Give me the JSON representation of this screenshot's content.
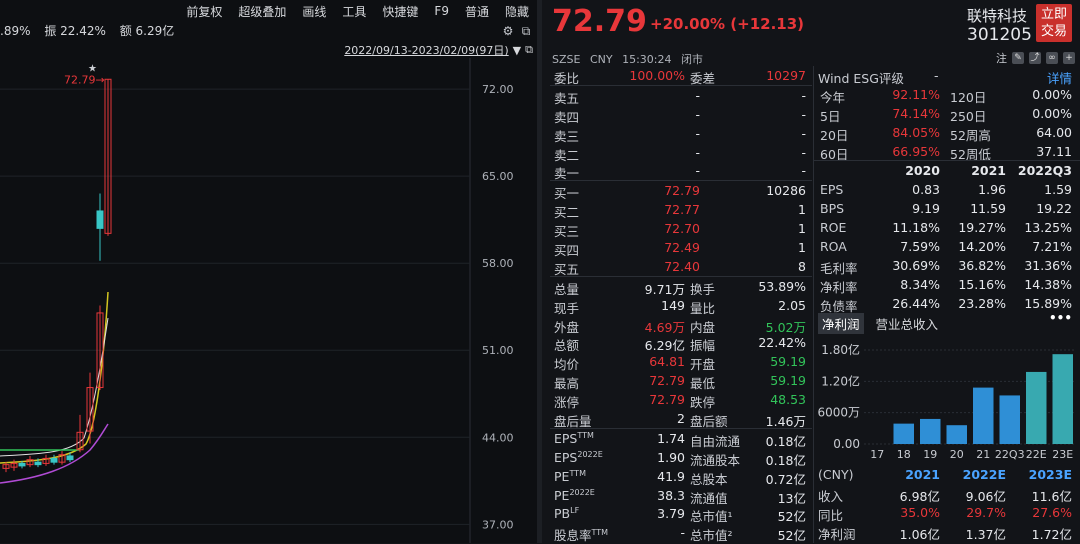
{
  "toolbar": {
    "items": [
      "前复权",
      "超级叠加",
      "画线",
      "工具",
      "快捷键",
      "F9",
      "普通",
      "隐藏"
    ]
  },
  "info": {
    "a": ".89%",
    "b": "振 22.42%",
    "c": "额 6.29亿"
  },
  "range": {
    "label": "2022/09/13-2023/02/09(97日)"
  },
  "chart_data": {
    "type": "candlestick",
    "y_ticks": [
      72.0,
      65.0,
      58.0,
      51.0,
      44.0,
      37.0
    ],
    "high_label": "72.79",
    "ylim": [
      35.5,
      74.5
    ],
    "candles": [
      {
        "o": 41.5,
        "c": 41.8,
        "h": 42.0,
        "l": 41.2
      },
      {
        "o": 41.6,
        "c": 41.9,
        "h": 42.2,
        "l": 41.3
      },
      {
        "o": 41.9,
        "c": 41.7,
        "h": 42.1,
        "l": 41.5
      },
      {
        "o": 41.8,
        "c": 42.2,
        "h": 42.5,
        "l": 41.6
      },
      {
        "o": 42.0,
        "c": 41.8,
        "h": 42.3,
        "l": 41.6
      },
      {
        "o": 41.9,
        "c": 42.3,
        "h": 42.6,
        "l": 41.7
      },
      {
        "o": 42.3,
        "c": 42.0,
        "h": 42.6,
        "l": 41.8
      },
      {
        "o": 42.0,
        "c": 42.6,
        "h": 42.9,
        "l": 41.8
      },
      {
        "o": 42.5,
        "c": 42.2,
        "h": 42.8,
        "l": 42.0
      },
      {
        "o": 43.0,
        "c": 44.4,
        "h": 45.8,
        "l": 42.8
      },
      {
        "o": 44.5,
        "c": 48.0,
        "h": 49.2,
        "l": 43.5
      },
      {
        "o": 48.0,
        "c": 54.0,
        "h": 54.6,
        "l": 47.8
      },
      {
        "o": 62.2,
        "c": 60.8,
        "h": 63.6,
        "l": 58.2
      },
      {
        "o": 60.4,
        "c": 72.79,
        "h": 72.79,
        "l": 60.2
      }
    ]
  },
  "header": {
    "price": "72.79",
    "change": "+20.00% (+12.13)",
    "exchange": "SZSE",
    "currency": "CNY",
    "time": "15:30:24",
    "status": "闭市",
    "name": "联特科技",
    "code": "301205",
    "buy": [
      "立即",
      "交易"
    ],
    "note": "注"
  },
  "order": {
    "wb": [
      "委比",
      "100.00%",
      "委差",
      "10297"
    ],
    "asks": [
      [
        "卖五",
        "-",
        "-"
      ],
      [
        "卖四",
        "-",
        "-"
      ],
      [
        "卖三",
        "-",
        "-"
      ],
      [
        "卖二",
        "-",
        "-"
      ],
      [
        "卖一",
        "-",
        "-"
      ]
    ],
    "bids": [
      [
        "买一",
        "72.79",
        "10286"
      ],
      [
        "买二",
        "72.77",
        "1"
      ],
      [
        "买三",
        "72.70",
        "1"
      ],
      [
        "买四",
        "72.49",
        "1"
      ],
      [
        "买五",
        "72.40",
        "8"
      ]
    ]
  },
  "stats": [
    [
      "总量",
      "9.71万",
      "",
      "换手",
      "53.89%",
      ""
    ],
    [
      "现手",
      "149",
      "",
      "量比",
      "2.05",
      ""
    ],
    [
      "外盘",
      "4.69万",
      "red",
      "内盘",
      "5.02万",
      "green"
    ],
    [
      "总额",
      "6.29亿",
      "",
      "振幅",
      "22.42%",
      ""
    ],
    [
      "均价",
      "64.81",
      "red",
      "开盘",
      "59.19",
      "green"
    ],
    [
      "最高",
      "72.79",
      "red",
      "最低",
      "59.19",
      "green"
    ],
    [
      "涨停",
      "72.79",
      "red",
      "跌停",
      "48.53",
      "green"
    ],
    [
      "盘后量",
      "2",
      "",
      "盘后额",
      "1.46万",
      ""
    ]
  ],
  "fund": [
    [
      "EPS",
      "TTM",
      "1.74",
      "自由流通",
      "0.18亿"
    ],
    [
      "EPS",
      "2022E",
      "1.90",
      "流通股本",
      "0.18亿"
    ],
    [
      "PE",
      "TTM",
      "41.9",
      "总股本",
      "0.72亿"
    ],
    [
      "PE",
      "2022E",
      "38.3",
      "流通值",
      "13亿"
    ],
    [
      "PB",
      "LF",
      "3.79",
      "总市值¹",
      "52亿"
    ],
    [
      "股息率",
      "TTM",
      "-",
      "总市值²",
      "52亿"
    ]
  ],
  "esg": {
    "label": "Wind ESG评级",
    "value": "-",
    "detail": "详情"
  },
  "perf": [
    [
      "今年",
      "92.11%",
      "120日",
      "0.00%"
    ],
    [
      "5日",
      "74.14%",
      "250日",
      "0.00%"
    ],
    [
      "20日",
      "84.05%",
      "52周高",
      "64.00"
    ],
    [
      "60日",
      "66.95%",
      "52周低",
      "37.11"
    ]
  ],
  "fin": {
    "years": [
      "2020",
      "2021",
      "2022Q3"
    ],
    "rows": [
      [
        "EPS",
        "0.83",
        "1.96",
        "1.59"
      ],
      [
        "BPS",
        "9.19",
        "11.59",
        "19.22"
      ],
      [
        "ROE",
        "11.18%",
        "19.27%",
        "13.25%"
      ],
      [
        "ROA",
        "7.59%",
        "14.20%",
        "7.21%"
      ],
      [
        "毛利率",
        "30.69%",
        "36.82%",
        "31.36%"
      ],
      [
        "净利率",
        "8.34%",
        "15.16%",
        "14.38%"
      ],
      [
        "负债率",
        "26.44%",
        "23.28%",
        "15.89%"
      ]
    ]
  },
  "tabs": [
    "净利润",
    "营业总收入"
  ],
  "bar_chart": {
    "type": "bar",
    "categories": [
      "17",
      "18",
      "19",
      "20",
      "21",
      "22Q3",
      "22E",
      "23E"
    ],
    "values": [
      0,
      0.39,
      0.48,
      0.36,
      1.08,
      0.93,
      1.38,
      1.72
    ],
    "y_ticks": [
      "1.80亿",
      "1.20亿",
      "6000万",
      "0.00"
    ],
    "colors": [
      "#2f8fd6",
      "#2f8fd6",
      "#2f8fd6",
      "#2f8fd6",
      "#2f8fd6",
      "#2f8fd6",
      "#38a9b0",
      "#38a9b0"
    ]
  },
  "forecast": {
    "head": [
      "(CNY)",
      "2021",
      "2022E",
      "2023E"
    ],
    "rows": [
      [
        "收入",
        "6.98亿",
        "9.06亿",
        "11.6亿"
      ],
      [
        "同比",
        "35.0%",
        "29.7%",
        "27.6%"
      ],
      [
        "净利润",
        "1.06亿",
        "1.37亿",
        "1.72亿"
      ]
    ]
  }
}
